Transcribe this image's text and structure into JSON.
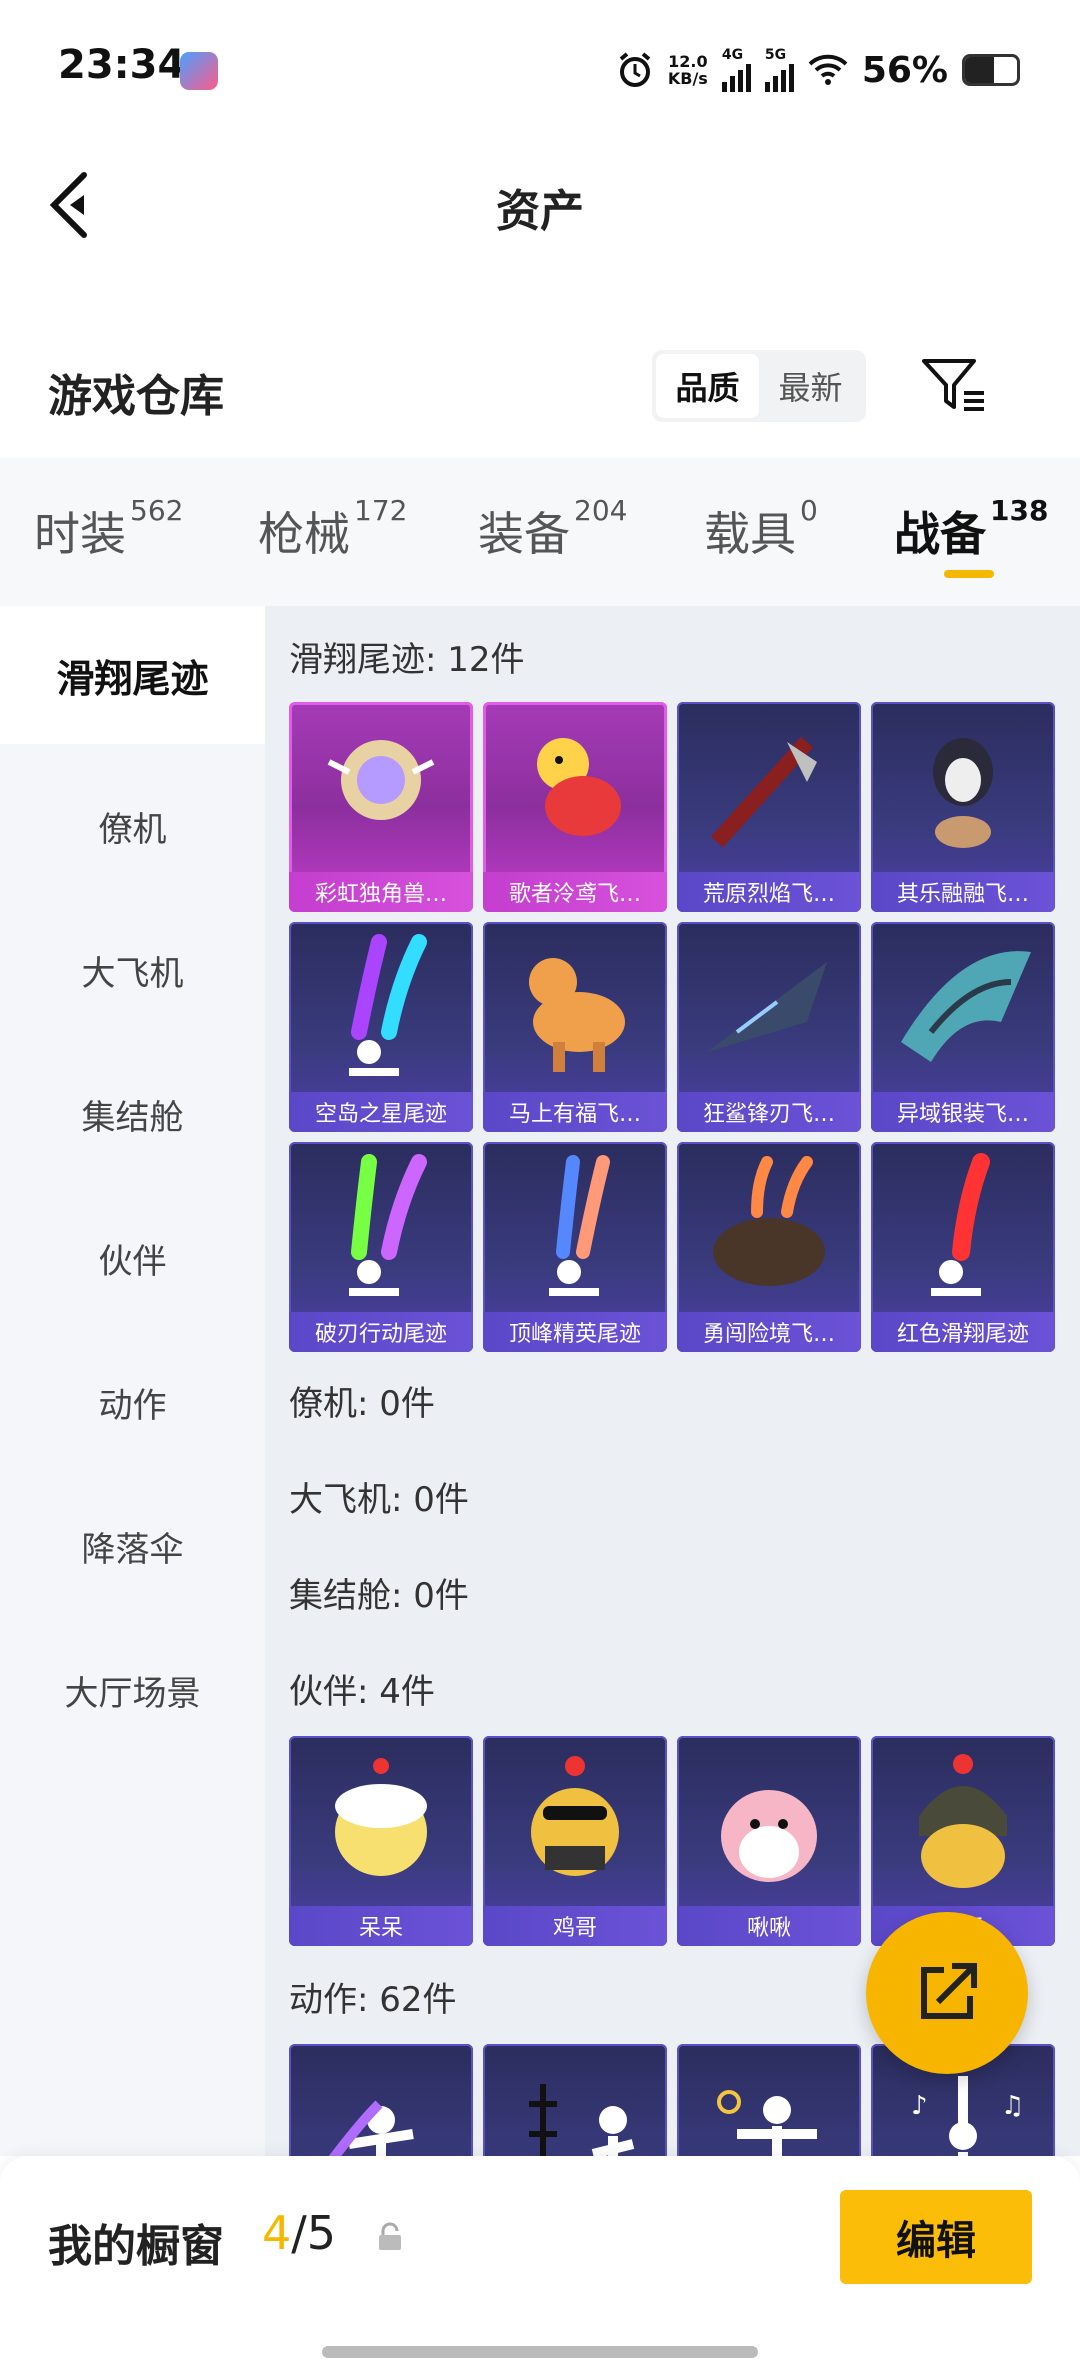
{
  "status_bar": {
    "time": "23:34",
    "net_speed": "12.0",
    "net_unit": "KB/s",
    "net1": "4G",
    "net2": "5G",
    "battery": "56%",
    "battery_level": 0.56
  },
  "header": {
    "title": "资产"
  },
  "page_heading": "游戏仓库",
  "sort": {
    "quality": "品质",
    "latest": "最新"
  },
  "tabs": [
    {
      "label": "时装",
      "count": "562"
    },
    {
      "label": "枪械",
      "count": "172"
    },
    {
      "label": "装备",
      "count": "204"
    },
    {
      "label": "载具",
      "count": "0"
    },
    {
      "label": "战备",
      "count": "138"
    }
  ],
  "sidebar": [
    "滑翔尾迹",
    "僚机",
    "大飞机",
    "集结舱",
    "伙伴",
    "动作",
    "降落伞",
    "大厅场景"
  ],
  "sections": {
    "glide": {
      "label": "滑翔尾迹: 12件",
      "items": [
        "彩虹独角兽…",
        "歌者泠鸢飞…",
        "荒原烈焰飞…",
        "其乐融融飞…",
        "空岛之星尾迹",
        "马上有福飞…",
        "狂鲨锋刃飞…",
        "异域银装飞…",
        "破刃行动尾迹",
        "顶峰精英尾迹",
        "勇闯险境飞…",
        "红色滑翔尾迹"
      ]
    },
    "wingman": {
      "label": "僚机: 0件"
    },
    "plane": {
      "label": "大飞机: 0件"
    },
    "pod": {
      "label": "集结舱: 0件"
    },
    "partner": {
      "label": "伙伴: 4件",
      "items": [
        "呆呆",
        "鸡哥",
        "啾啾",
        "…杨"
      ]
    },
    "emote": {
      "label": "动作: 62件"
    }
  },
  "bottom": {
    "shop_label": "我的橱窗",
    "used": "4",
    "total": "/5",
    "edit": "编辑"
  }
}
